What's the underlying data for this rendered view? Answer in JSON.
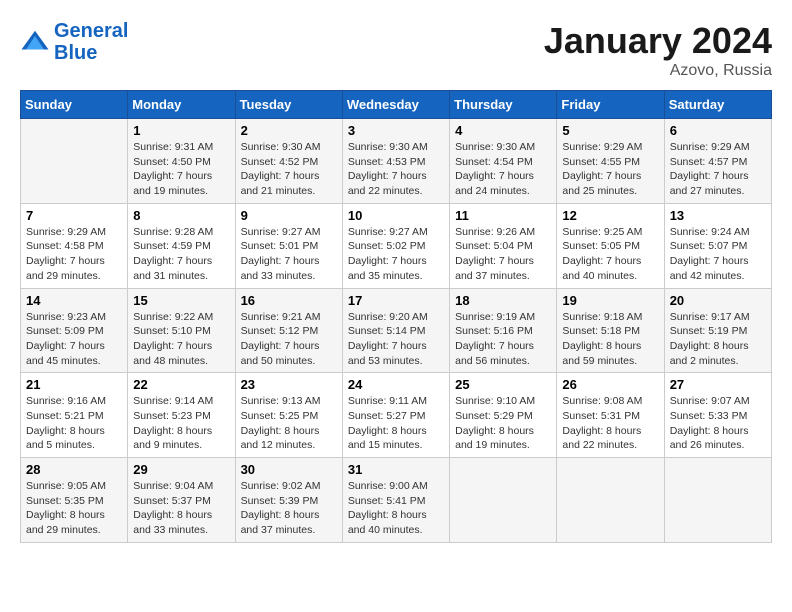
{
  "header": {
    "logo_line1": "General",
    "logo_line2": "Blue",
    "month": "January 2024",
    "location": "Azovo, Russia"
  },
  "days_of_week": [
    "Sunday",
    "Monday",
    "Tuesday",
    "Wednesday",
    "Thursday",
    "Friday",
    "Saturday"
  ],
  "weeks": [
    [
      {
        "day": "",
        "sunrise": "",
        "sunset": "",
        "daylight": ""
      },
      {
        "day": "1",
        "sunrise": "9:31 AM",
        "sunset": "4:50 PM",
        "daylight": "7 hours and 19 minutes."
      },
      {
        "day": "2",
        "sunrise": "9:30 AM",
        "sunset": "4:52 PM",
        "daylight": "7 hours and 21 minutes."
      },
      {
        "day": "3",
        "sunrise": "9:30 AM",
        "sunset": "4:53 PM",
        "daylight": "7 hours and 22 minutes."
      },
      {
        "day": "4",
        "sunrise": "9:30 AM",
        "sunset": "4:54 PM",
        "daylight": "7 hours and 24 minutes."
      },
      {
        "day": "5",
        "sunrise": "9:29 AM",
        "sunset": "4:55 PM",
        "daylight": "7 hours and 25 minutes."
      },
      {
        "day": "6",
        "sunrise": "9:29 AM",
        "sunset": "4:57 PM",
        "daylight": "7 hours and 27 minutes."
      }
    ],
    [
      {
        "day": "7",
        "sunrise": "9:29 AM",
        "sunset": "4:58 PM",
        "daylight": "7 hours and 29 minutes."
      },
      {
        "day": "8",
        "sunrise": "9:28 AM",
        "sunset": "4:59 PM",
        "daylight": "7 hours and 31 minutes."
      },
      {
        "day": "9",
        "sunrise": "9:27 AM",
        "sunset": "5:01 PM",
        "daylight": "7 hours and 33 minutes."
      },
      {
        "day": "10",
        "sunrise": "9:27 AM",
        "sunset": "5:02 PM",
        "daylight": "7 hours and 35 minutes."
      },
      {
        "day": "11",
        "sunrise": "9:26 AM",
        "sunset": "5:04 PM",
        "daylight": "7 hours and 37 minutes."
      },
      {
        "day": "12",
        "sunrise": "9:25 AM",
        "sunset": "5:05 PM",
        "daylight": "7 hours and 40 minutes."
      },
      {
        "day": "13",
        "sunrise": "9:24 AM",
        "sunset": "5:07 PM",
        "daylight": "7 hours and 42 minutes."
      }
    ],
    [
      {
        "day": "14",
        "sunrise": "9:23 AM",
        "sunset": "5:09 PM",
        "daylight": "7 hours and 45 minutes."
      },
      {
        "day": "15",
        "sunrise": "9:22 AM",
        "sunset": "5:10 PM",
        "daylight": "7 hours and 48 minutes."
      },
      {
        "day": "16",
        "sunrise": "9:21 AM",
        "sunset": "5:12 PM",
        "daylight": "7 hours and 50 minutes."
      },
      {
        "day": "17",
        "sunrise": "9:20 AM",
        "sunset": "5:14 PM",
        "daylight": "7 hours and 53 minutes."
      },
      {
        "day": "18",
        "sunrise": "9:19 AM",
        "sunset": "5:16 PM",
        "daylight": "7 hours and 56 minutes."
      },
      {
        "day": "19",
        "sunrise": "9:18 AM",
        "sunset": "5:18 PM",
        "daylight": "8 hours and 59 minutes."
      },
      {
        "day": "20",
        "sunrise": "9:17 AM",
        "sunset": "5:19 PM",
        "daylight": "8 hours and 2 minutes."
      }
    ],
    [
      {
        "day": "21",
        "sunrise": "9:16 AM",
        "sunset": "5:21 PM",
        "daylight": "8 hours and 5 minutes."
      },
      {
        "day": "22",
        "sunrise": "9:14 AM",
        "sunset": "5:23 PM",
        "daylight": "8 hours and 9 minutes."
      },
      {
        "day": "23",
        "sunrise": "9:13 AM",
        "sunset": "5:25 PM",
        "daylight": "8 hours and 12 minutes."
      },
      {
        "day": "24",
        "sunrise": "9:11 AM",
        "sunset": "5:27 PM",
        "daylight": "8 hours and 15 minutes."
      },
      {
        "day": "25",
        "sunrise": "9:10 AM",
        "sunset": "5:29 PM",
        "daylight": "8 hours and 19 minutes."
      },
      {
        "day": "26",
        "sunrise": "9:08 AM",
        "sunset": "5:31 PM",
        "daylight": "8 hours and 22 minutes."
      },
      {
        "day": "27",
        "sunrise": "9:07 AM",
        "sunset": "5:33 PM",
        "daylight": "8 hours and 26 minutes."
      }
    ],
    [
      {
        "day": "28",
        "sunrise": "9:05 AM",
        "sunset": "5:35 PM",
        "daylight": "8 hours and 29 minutes."
      },
      {
        "day": "29",
        "sunrise": "9:04 AM",
        "sunset": "5:37 PM",
        "daylight": "8 hours and 33 minutes."
      },
      {
        "day": "30",
        "sunrise": "9:02 AM",
        "sunset": "5:39 PM",
        "daylight": "8 hours and 37 minutes."
      },
      {
        "day": "31",
        "sunrise": "9:00 AM",
        "sunset": "5:41 PM",
        "daylight": "8 hours and 40 minutes."
      },
      {
        "day": "",
        "sunrise": "",
        "sunset": "",
        "daylight": ""
      },
      {
        "day": "",
        "sunrise": "",
        "sunset": "",
        "daylight": ""
      },
      {
        "day": "",
        "sunrise": "",
        "sunset": "",
        "daylight": ""
      }
    ]
  ]
}
